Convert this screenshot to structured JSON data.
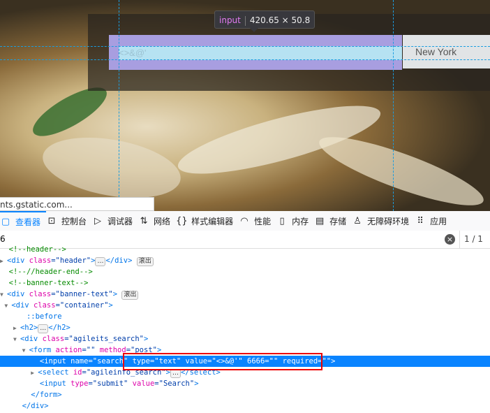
{
  "page": {
    "input_value": "<>&@'",
    "select_value": "New York",
    "status_url": "nts.gstatic.com..."
  },
  "highlighter": {
    "tag": "input",
    "size": "420.65 × 50.8"
  },
  "toolbar": {
    "tabs": [
      {
        "label": "查看器",
        "icon": "inspector-icon",
        "active": true
      },
      {
        "label": "控制台",
        "icon": "console-icon"
      },
      {
        "label": "调试器",
        "icon": "debugger-icon"
      },
      {
        "label": "网络",
        "icon": "network-icon"
      },
      {
        "label": "样式编辑器",
        "icon": "style-editor-icon"
      },
      {
        "label": "性能",
        "icon": "performance-icon"
      },
      {
        "label": "内存",
        "icon": "memory-icon"
      },
      {
        "label": "存储",
        "icon": "storage-icon"
      },
      {
        "label": "无障碍环境",
        "icon": "accessibility-icon"
      },
      {
        "label": "应用",
        "icon": "application-icon"
      }
    ]
  },
  "search": {
    "value": "6",
    "count": "1 / 1"
  },
  "badges": {
    "overflow": "滚出",
    "ellipsis": "…"
  },
  "tree": {
    "l0": "<!--header-->",
    "l1": [
      "<div",
      " class",
      "=\"header\"",
      ">",
      "</div>"
    ],
    "l2": "<!--//header-end-->",
    "l3": "<!--banner-text-->",
    "l4": [
      "<div",
      " class",
      "=\"banner-text\"",
      ">"
    ],
    "l5": [
      "<div",
      " class",
      "=\"container\"",
      ">"
    ],
    "l6": "::before",
    "l7": [
      "<h2>",
      "</h2>"
    ],
    "l8": [
      "<div",
      " class",
      "=\"agileits_search\"",
      ">"
    ],
    "l9": [
      "<form",
      " action",
      "=\"\"",
      " method",
      "=\"post\"",
      ">"
    ],
    "l10": "<input name=\"search\" type=\"text\" value=\"<>&@'\" 6666=\"\" required=\"\">",
    "l11": [
      "<select",
      " id",
      "=\"agileinfo_search\"",
      ">",
      "</select>"
    ],
    "l12": [
      "<input",
      " type",
      "=\"submit\"",
      " value",
      "=\"Search\"",
      ">"
    ],
    "l13": "</form>",
    "l14": "</div>"
  },
  "colors": {
    "accent": "#0a84ff",
    "highlight_box": "#e00000"
  }
}
